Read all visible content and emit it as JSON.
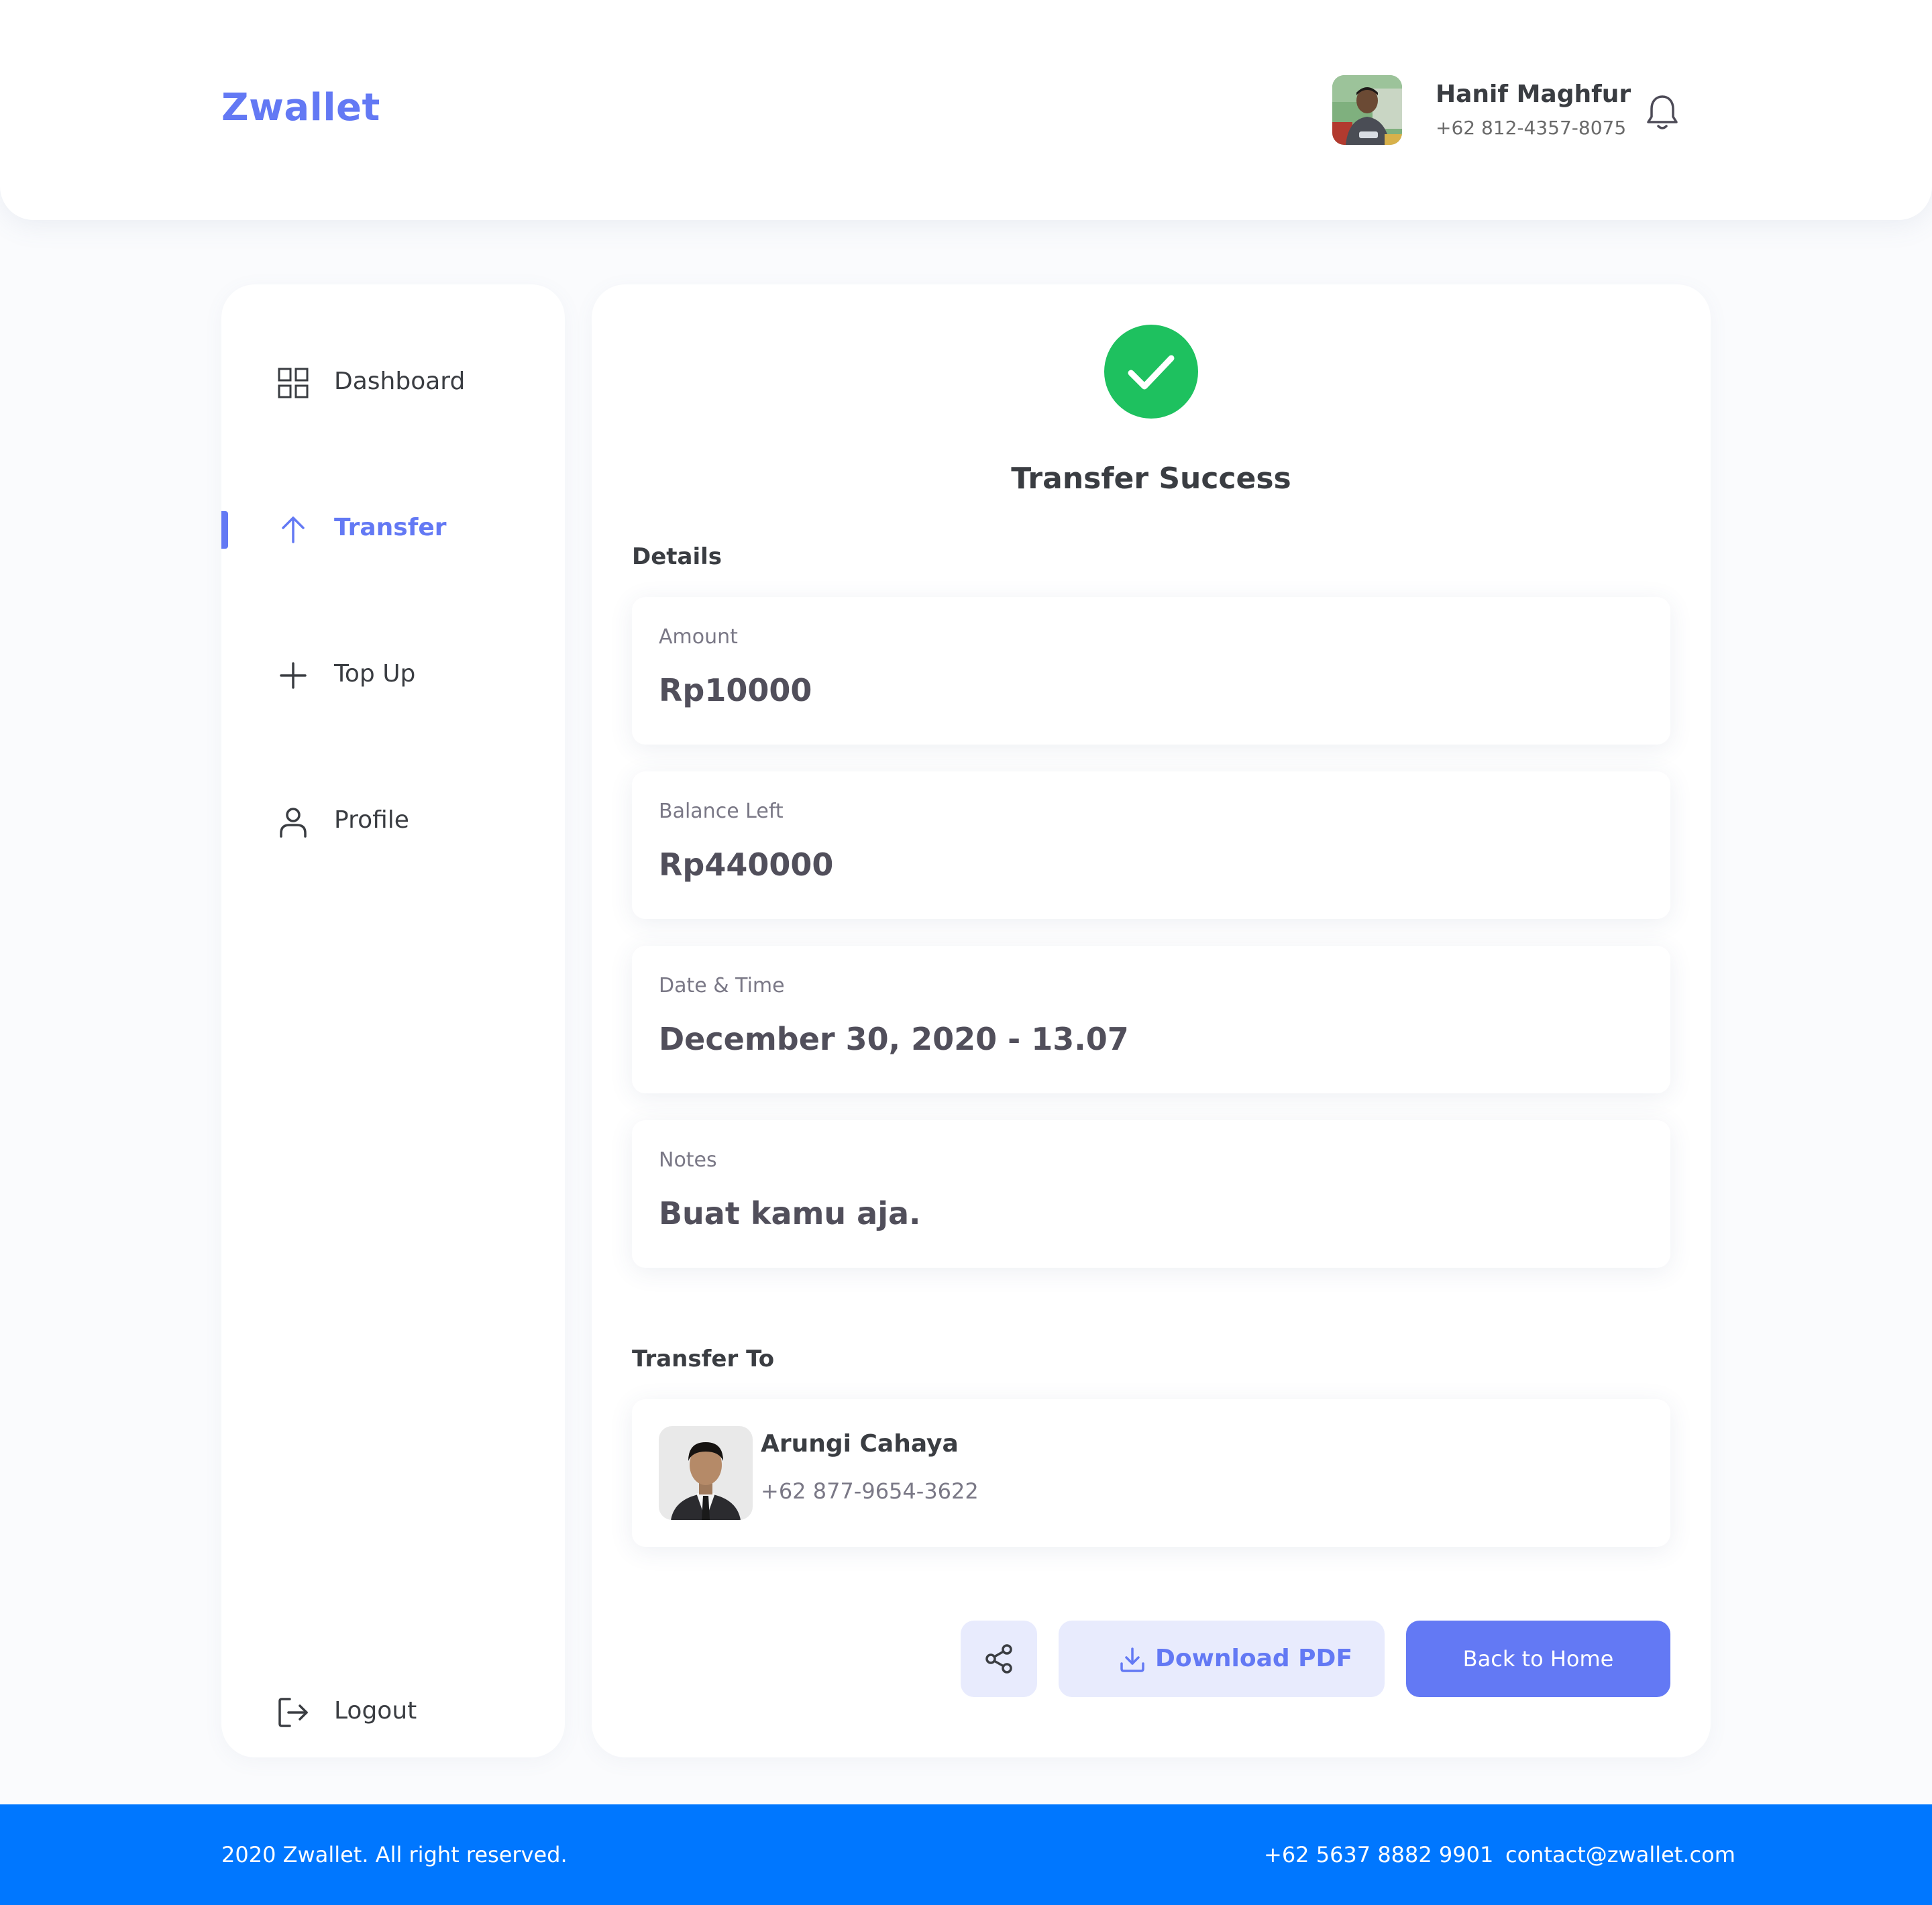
{
  "app": {
    "brand": "Zwallet"
  },
  "header": {
    "user_name": "Hanif Maghfur",
    "user_phone": "+62 812-4357-8075",
    "avatar_icon": "user-photo",
    "notification_icon": "bell-icon"
  },
  "sidebar": {
    "items": [
      {
        "label": "Dashboard",
        "icon": "grid-icon",
        "active": false
      },
      {
        "label": "Transfer",
        "icon": "arrow-up-icon",
        "active": true
      },
      {
        "label": "Top Up",
        "icon": "plus-icon",
        "active": false
      },
      {
        "label": "Profile",
        "icon": "user-icon",
        "active": false
      }
    ],
    "logout": {
      "label": "Logout",
      "icon": "logout-icon"
    }
  },
  "main": {
    "status_icon": "check-icon",
    "title": "Transfer Success",
    "details_heading": "Details",
    "details": [
      {
        "label": "Amount",
        "value": "Rp10000"
      },
      {
        "label": "Balance Left",
        "value": "Rp440000"
      },
      {
        "label": "Date & Time",
        "value": "December 30, 2020 - 13.07"
      },
      {
        "label": "Notes",
        "value": "Buat kamu aja."
      }
    ],
    "transfer_to_heading": "Transfer To",
    "recipient": {
      "name": "Arungi Cahaya",
      "phone": "+62 877-9654-3622"
    },
    "actions": {
      "share_icon": "share-icon",
      "download_label": "Download PDF",
      "download_icon": "download-icon",
      "home_label": "Back to Home"
    }
  },
  "footer": {
    "copyright": "2020 Zwallet. All right reserved.",
    "phone": "+62 5637 8882 9901",
    "email": "contact@zwallet.com"
  },
  "colors": {
    "primary": "#6379F4",
    "success": "#1EC15F",
    "footer_bg": "#0077FF",
    "page_bg": "#FAFBFD"
  }
}
